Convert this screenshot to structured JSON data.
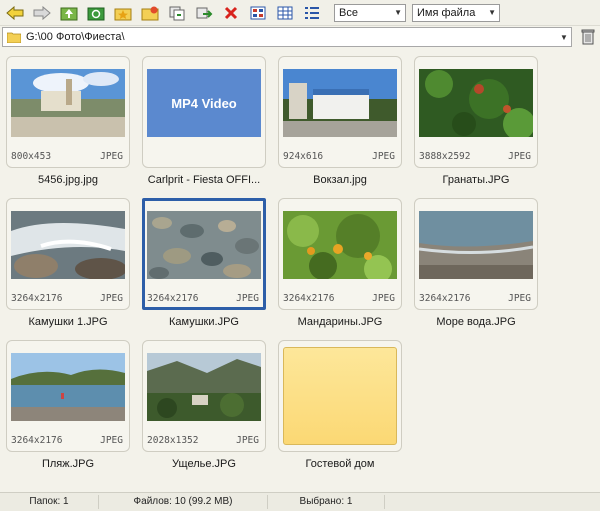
{
  "toolbar": {
    "filter_combo": "Все",
    "sort_combo": "Имя файла"
  },
  "path": {
    "value": "G:\\00 Фото\\Фиеста\\"
  },
  "items": [
    {
      "name": "5456.jpg.jpg",
      "size": "800x453",
      "type": "JPEG"
    },
    {
      "name": "Carlprit - Fiesta OFFI...",
      "size": "",
      "type": "",
      "label": "MP4 Video"
    },
    {
      "name": "Вокзал.jpg",
      "size": "924x616",
      "type": "JPEG"
    },
    {
      "name": "Гранаты.JPG",
      "size": "3888x2592",
      "type": "JPEG"
    },
    {
      "name": "Камушки 1.JPG",
      "size": "3264x2176",
      "type": "JPEG"
    },
    {
      "name": "Камушки.JPG",
      "size": "3264x2176",
      "type": "JPEG"
    },
    {
      "name": "Мандарины.JPG",
      "size": "3264x2176",
      "type": "JPEG"
    },
    {
      "name": "Море вода.JPG",
      "size": "3264x2176",
      "type": "JPEG"
    },
    {
      "name": "Пляж.JPG",
      "size": "3264x2176",
      "type": "JPEG"
    },
    {
      "name": "Ущелье.JPG",
      "size": "2028x1352",
      "type": "JPEG"
    },
    {
      "name": "Гостевой дом",
      "size": "",
      "type": ""
    }
  ],
  "status": {
    "folders": "Папок: 1",
    "files": "Файлов: 10 (99.2 MB)",
    "selected": "Выбрано: 1"
  },
  "colors": {
    "selection": "#2d5ea8",
    "folder": "#fbd874",
    "mp4": "#5b89cf"
  }
}
